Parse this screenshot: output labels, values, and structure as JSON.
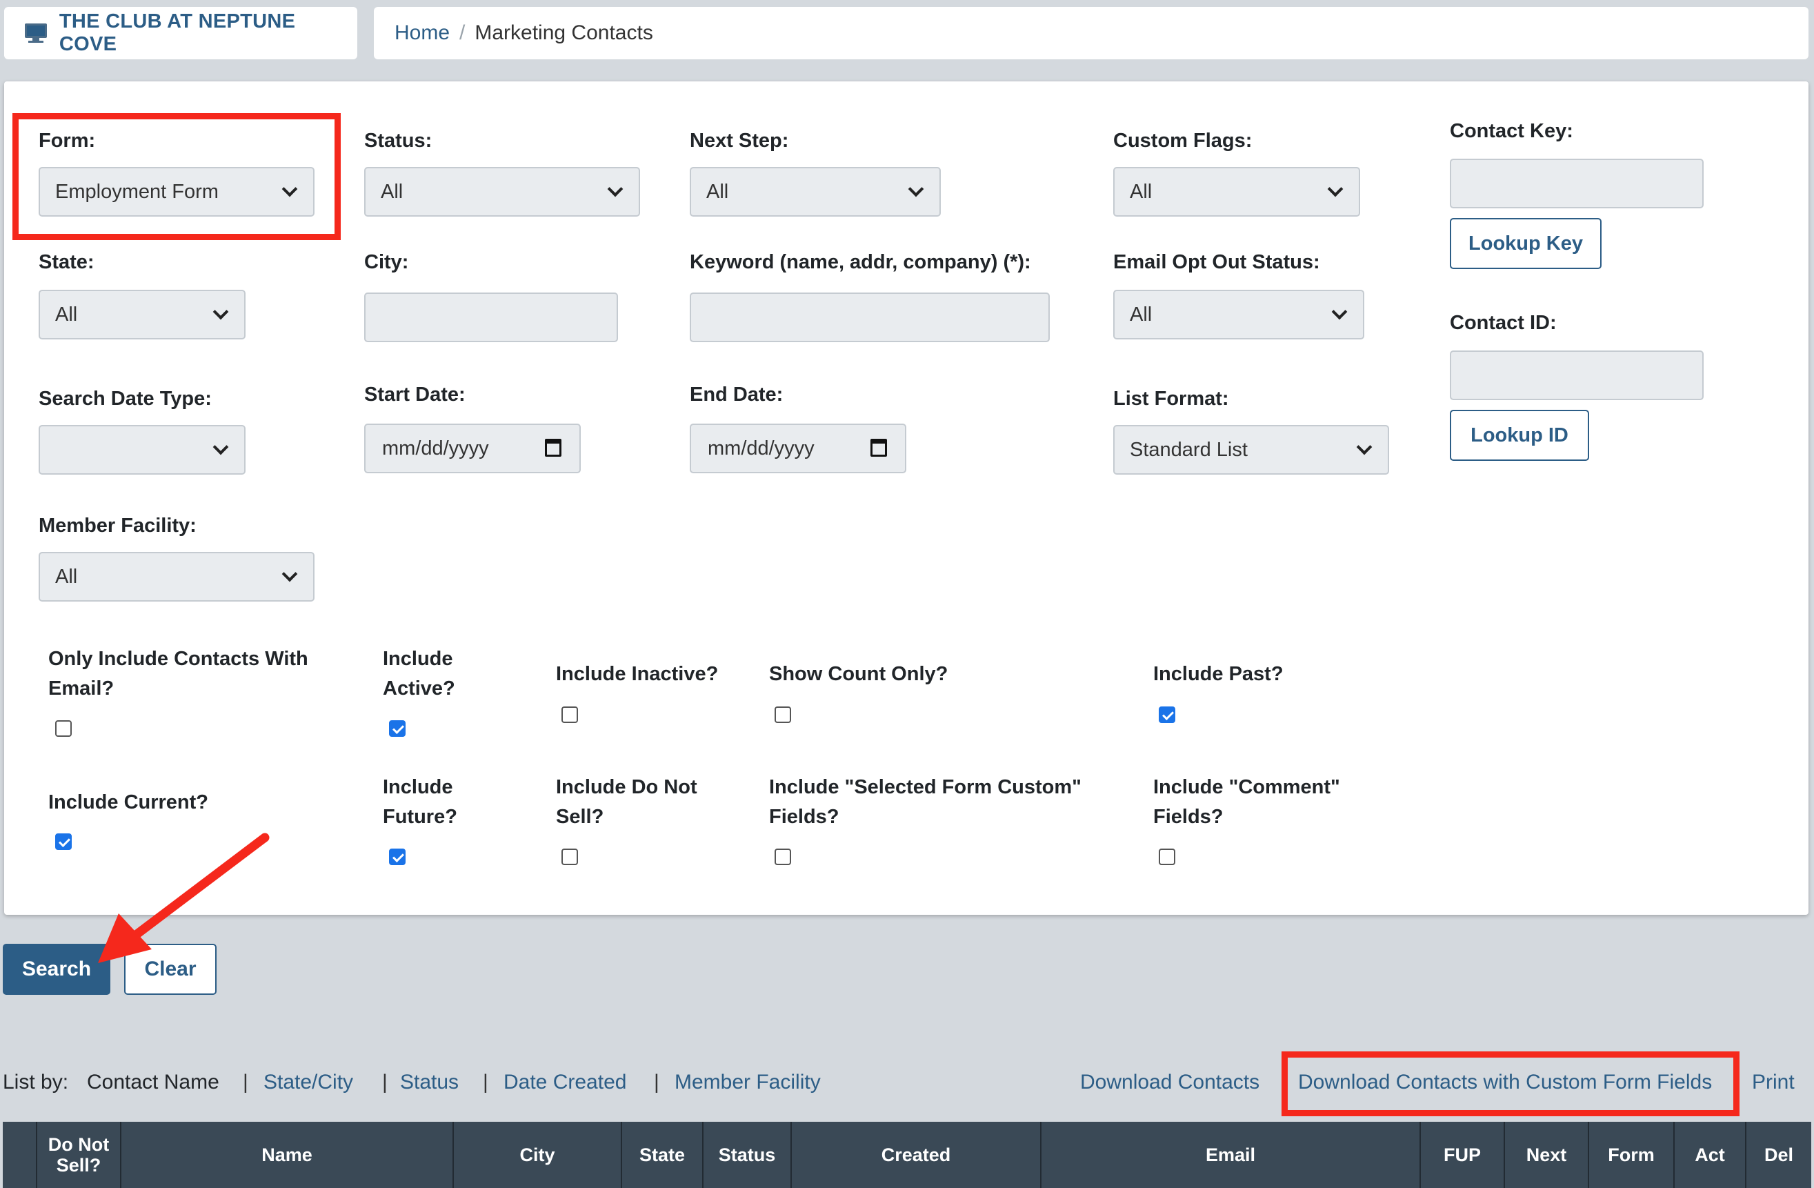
{
  "header": {
    "brand": "THE CLUB AT NEPTUNE COVE",
    "breadcrumb_home": "Home",
    "breadcrumb_sep": "/",
    "breadcrumb_current": "Marketing Contacts"
  },
  "filters": {
    "form": {
      "label": "Form:",
      "value": "Employment Form"
    },
    "status": {
      "label": "Status:",
      "value": "All"
    },
    "next_step": {
      "label": "Next Step:",
      "value": "All"
    },
    "custom_flags": {
      "label": "Custom Flags:",
      "value": "All"
    },
    "contact_key": {
      "label": "Contact Key:",
      "value": "",
      "button": "Lookup Key"
    },
    "state": {
      "label": "State:",
      "value": "All"
    },
    "city": {
      "label": "City:",
      "value": ""
    },
    "keyword": {
      "label": "Keyword (name, addr, company) (*):",
      "value": ""
    },
    "email_opt_out": {
      "label": "Email Opt Out Status:",
      "value": "All"
    },
    "contact_id": {
      "label": "Contact ID:",
      "value": "",
      "button": "Lookup ID"
    },
    "search_date_type": {
      "label": "Search Date Type:",
      "value": ""
    },
    "start_date": {
      "label": "Start Date:",
      "placeholder": "mm/dd/yyyy"
    },
    "end_date": {
      "label": "End Date:",
      "placeholder": "mm/dd/yyyy"
    },
    "list_format": {
      "label": "List Format:",
      "value": "Standard List"
    },
    "member_facility": {
      "label": "Member Facility:",
      "value": "All"
    }
  },
  "checkboxes": [
    {
      "label_1": "Only Include Contacts With",
      "label_2": "Email?",
      "checked": false
    },
    {
      "label_1": "Include",
      "label_2": "Active?",
      "checked": true
    },
    {
      "label_1": "Include Inactive?",
      "checked": false
    },
    {
      "label_1": "Show Count Only?",
      "checked": false
    },
    {
      "label_1": "Include Past?",
      "checked": true
    },
    {
      "label_1": "Include Current?",
      "checked": true
    },
    {
      "label_1": "Include",
      "label_2": "Future?",
      "checked": true
    },
    {
      "label_1": "Include Do Not",
      "label_2": "Sell?",
      "checked": false
    },
    {
      "label_1": "Include \"Selected Form Custom\"",
      "label_2": "Fields?",
      "checked": false
    },
    {
      "label_1": "Include \"Comment\"",
      "label_2": "Fields?",
      "checked": false
    }
  ],
  "actions": {
    "search": "Search",
    "clear": "Clear"
  },
  "list_by": {
    "label": "List by:",
    "current": "Contact Name",
    "separator": "|",
    "options": [
      "State/City",
      "Status",
      "Date Created",
      "Member Facility"
    ],
    "download": "Download Contacts",
    "download_custom": "Download Contacts with Custom Form Fields",
    "print": "Print"
  },
  "table": {
    "columns": [
      "",
      "Do Not Sell?",
      "Name",
      "City",
      "State",
      "Status",
      "Created",
      "Email",
      "FUP",
      "Next",
      "Form",
      "Act",
      "Del"
    ]
  },
  "colors": {
    "annotation": "#f5281c",
    "primary": "#2c5d86",
    "checkbox": "#1a73e8"
  }
}
